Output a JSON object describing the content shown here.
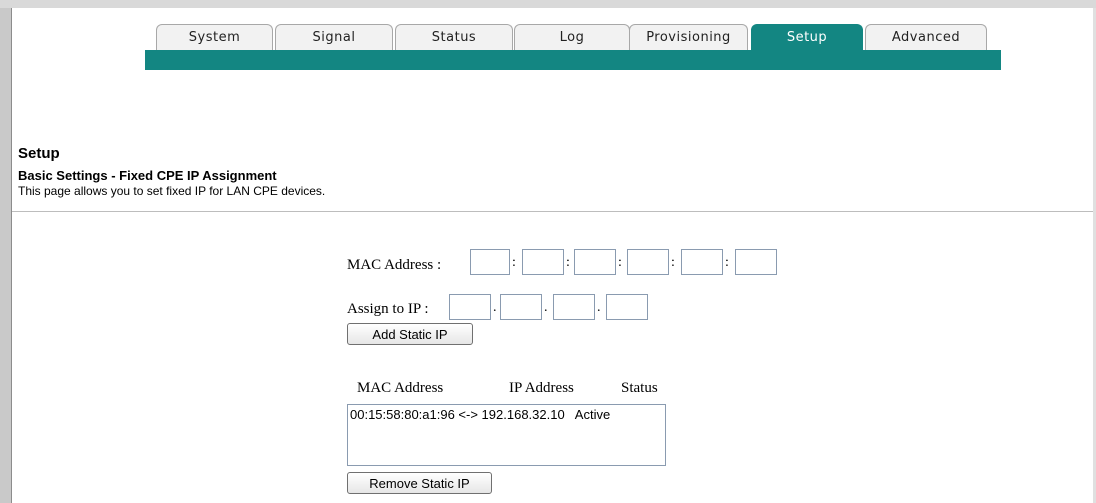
{
  "tabs": [
    {
      "label": "System",
      "active": false
    },
    {
      "label": "Signal",
      "active": false
    },
    {
      "label": "Status",
      "active": false
    },
    {
      "label": "Log",
      "active": false
    },
    {
      "label": "Provisioning",
      "active": false
    },
    {
      "label": "Setup",
      "active": true
    },
    {
      "label": "Advanced",
      "active": false
    }
  ],
  "colors": {
    "accent": "#138682",
    "tab_bg": "#f2f2f2"
  },
  "header": {
    "title": "Setup",
    "subtitle": "Basic Settings - Fixed CPE IP Assignment",
    "description": "This page allows you to set fixed IP for LAN CPE devices."
  },
  "form": {
    "mac_label": "MAC Address :",
    "mac_fields": [
      "",
      "",
      "",
      "",
      "",
      ""
    ],
    "mac_separator": ":",
    "ip_label": "Assign to IP :",
    "ip_fields": [
      "",
      "",
      "",
      ""
    ],
    "ip_separator": ".",
    "add_button": "Add Static IP"
  },
  "table": {
    "headers": [
      "MAC Address",
      "IP Address",
      "Status"
    ],
    "rows": [
      {
        "text": "00:15:58:80:a1:96 <-> 192.168.32.10   Active"
      }
    ],
    "remove_button": "Remove Static IP"
  }
}
